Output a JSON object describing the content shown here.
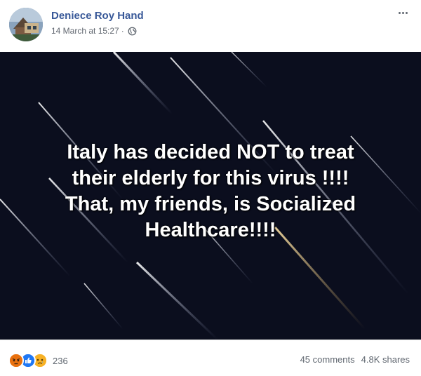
{
  "post": {
    "author": "Deniece Roy Hand",
    "timestamp": "14 March at 15:27",
    "separator": "·",
    "privacy_icon": "globe-icon",
    "menu_icon": "more-icon"
  },
  "image_text": {
    "lines": [
      "Italy has decided NOT to treat",
      "their elderly for this virus !!!!",
      "That, my friends, is Socialized",
      "Healthcare!!!!"
    ]
  },
  "footer": {
    "reaction_icons": [
      "angry-icon",
      "like-icon",
      "sad-icon"
    ],
    "reaction_count": "236",
    "comments": "45 comments",
    "shares": "4.8K shares"
  },
  "colors": {
    "author_link": "#385898",
    "meta_text": "#616770",
    "image_background": "#0b0e1e",
    "like_blue": "#2078f4",
    "angry_orange": "#e9710f",
    "sad_yellow": "#f7b125"
  }
}
